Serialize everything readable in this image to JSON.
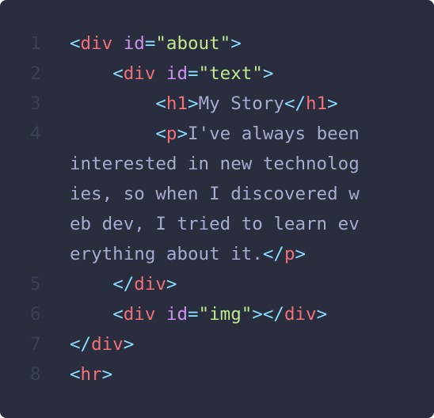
{
  "editor": {
    "background": "#292d3e",
    "colors": {
      "line_number": "#3b4057",
      "punctuation": "#89ddff",
      "tag": "#f07178",
      "attribute": "#c792ea",
      "string": "#c3e88d",
      "text": "#a6accd"
    },
    "line_numbers": [
      "1",
      "2",
      "3",
      "4",
      "5",
      "6",
      "7",
      "8"
    ],
    "lines": [
      {
        "indent": "",
        "open": "<",
        "tag": "div",
        "space": " ",
        "attr": "id",
        "eq": "=",
        "value": "\"about\"",
        "close": ">"
      },
      {
        "indent": "    ",
        "open": "<",
        "tag": "div",
        "space": " ",
        "attr": "id",
        "eq": "=",
        "value": "\"text\"",
        "close": ">"
      },
      {
        "indent": "        ",
        "open": "<",
        "tag": "h1",
        "close": ">",
        "text": "My Story",
        "end_open": "</",
        "end_tag": "h1",
        "end_close": ">"
      },
      {
        "indent": "        ",
        "open": "<",
        "tag": "p",
        "close": ">",
        "wrapped": [
          "I've always been",
          "interested in new technolog",
          "ies, so when I discovered w",
          "eb dev, I tried to learn ev",
          "erything about it."
        ],
        "end_open": "</",
        "end_tag": "p",
        "end_close": ">"
      },
      {
        "indent": "    ",
        "end_open": "</",
        "end_tag": "div",
        "end_close": ">"
      },
      {
        "indent": "    ",
        "open": "<",
        "tag": "div",
        "space": " ",
        "attr": "id",
        "eq": "=",
        "value": "\"img\"",
        "close": ">",
        "end_open": "</",
        "end_tag": "div",
        "end_close": ">"
      },
      {
        "indent": "",
        "end_open": "</",
        "end_tag": "div",
        "end_close": ">"
      },
      {
        "indent": "",
        "open": "<",
        "tag": "hr",
        "close": ">"
      }
    ]
  }
}
